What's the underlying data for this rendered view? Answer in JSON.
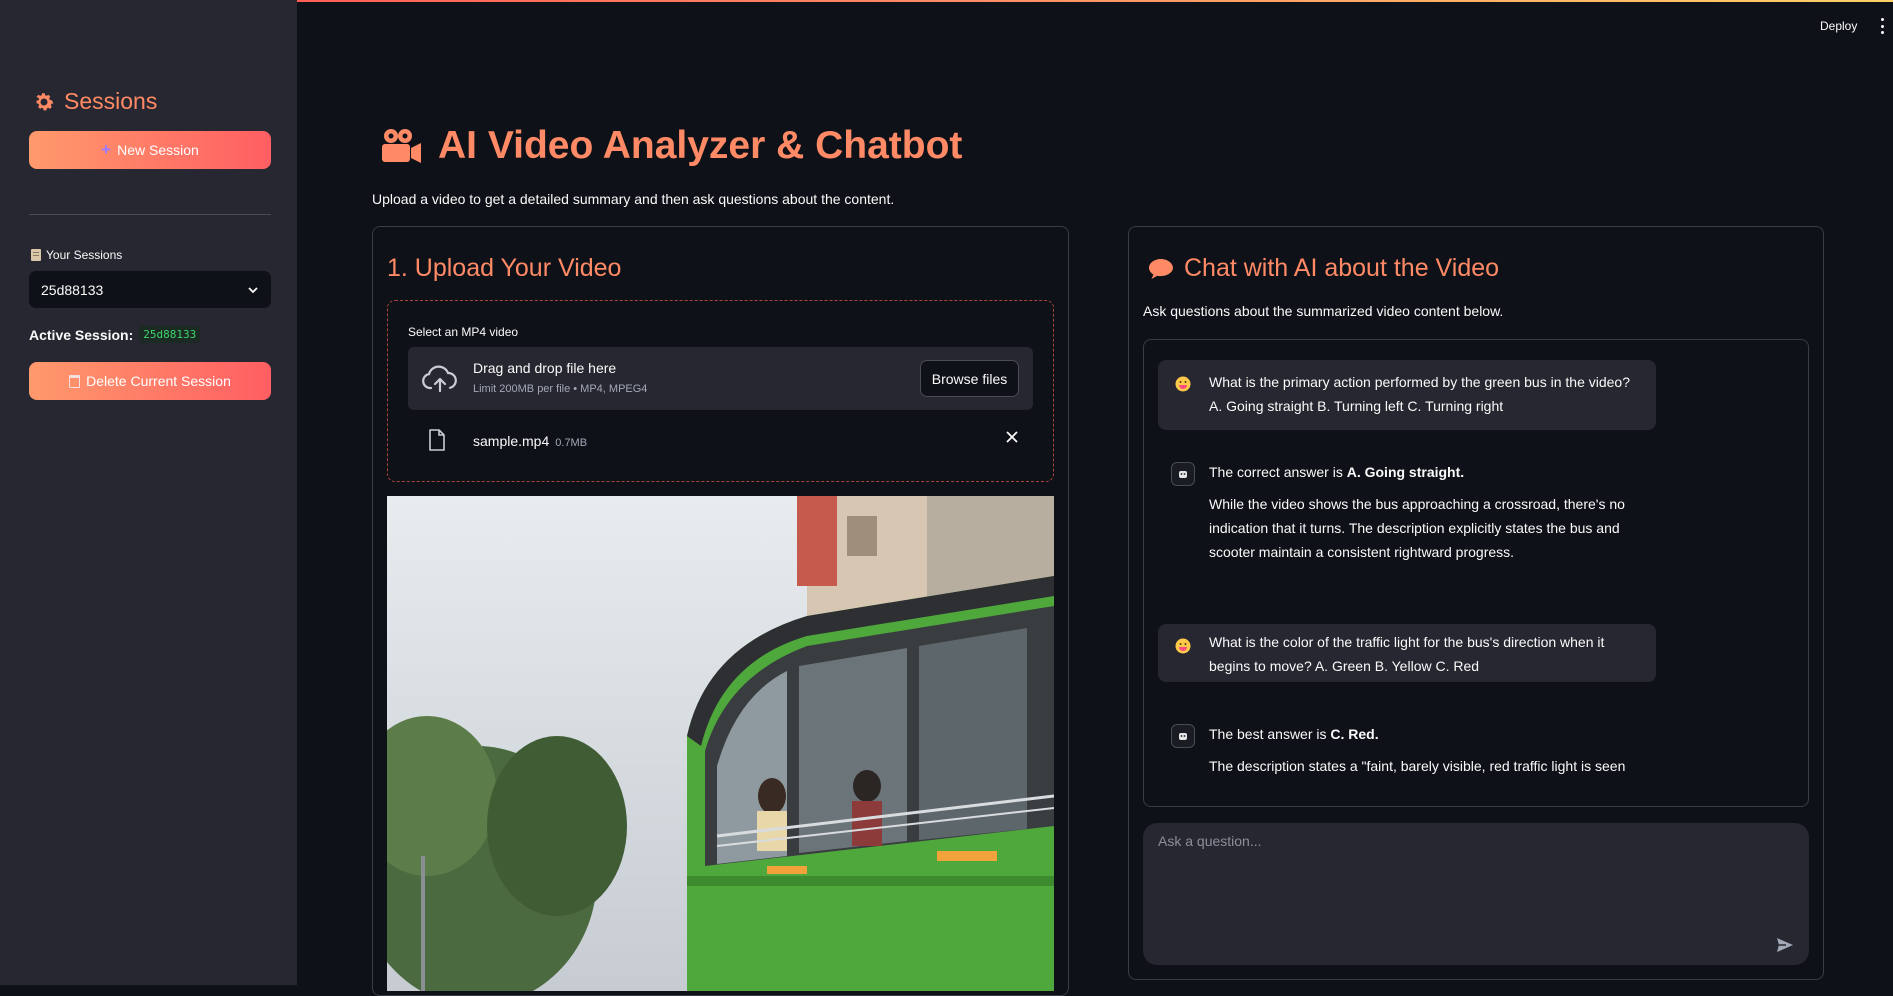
{
  "colors": {
    "accent": "#ff8a65",
    "sidebar_bg": "#262730",
    "page_bg": "#0e1117",
    "badge_green": "#3dd56d"
  },
  "topbar": {
    "deploy_label": "Deploy",
    "menu_icon": "kebab-menu-icon"
  },
  "sidebar": {
    "title": "Sessions",
    "title_icon": "gear-icon",
    "new_session_label": "New Session",
    "sessions_label": "Your Sessions",
    "selected_session": "25d88133",
    "active_label": "Active Session:",
    "active_id": "25d88133",
    "delete_label": "Delete Current Session"
  },
  "main": {
    "title": "AI Video Analyzer & Chatbot",
    "title_icon": "video-camera-icon",
    "subtitle": "Upload a video to get a detailed summary and then ask questions about the content."
  },
  "upload": {
    "heading": "1. Upload Your Video",
    "label": "Select an MP4 video",
    "drop_text": "Drag and drop file here",
    "limit_text": "Limit 200MB per file • MP4, MPEG4",
    "browse_label": "Browse files",
    "file_name": "sample.mp4",
    "file_size": "0.7MB"
  },
  "chat": {
    "heading": "Chat with AI about the Video",
    "intro": "Ask questions about the summarized video content below.",
    "messages": [
      {
        "role": "user",
        "lines": [
          "What is the primary action performed by the green bus in the video? A. Going straight B. Turning left C. Turning right"
        ]
      },
      {
        "role": "assistant",
        "answer_prefix": "The correct answer is ",
        "answer_bold": "A. Going straight.",
        "detail": "While the video shows the bus approaching a crossroad, there's no indication that it turns. The description explicitly states the bus and scooter maintain a consistent rightward progress."
      },
      {
        "role": "user",
        "lines": [
          "What is the color of the traffic light for the bus's direction when it begins to move? A. Green B. Yellow C. Red"
        ]
      },
      {
        "role": "assistant",
        "answer_prefix": "The best answer is ",
        "answer_bold": "C. Red.",
        "detail": "The description states a \"faint, barely visible, red traffic light is seen"
      }
    ],
    "input_placeholder": "Ask a question..."
  }
}
